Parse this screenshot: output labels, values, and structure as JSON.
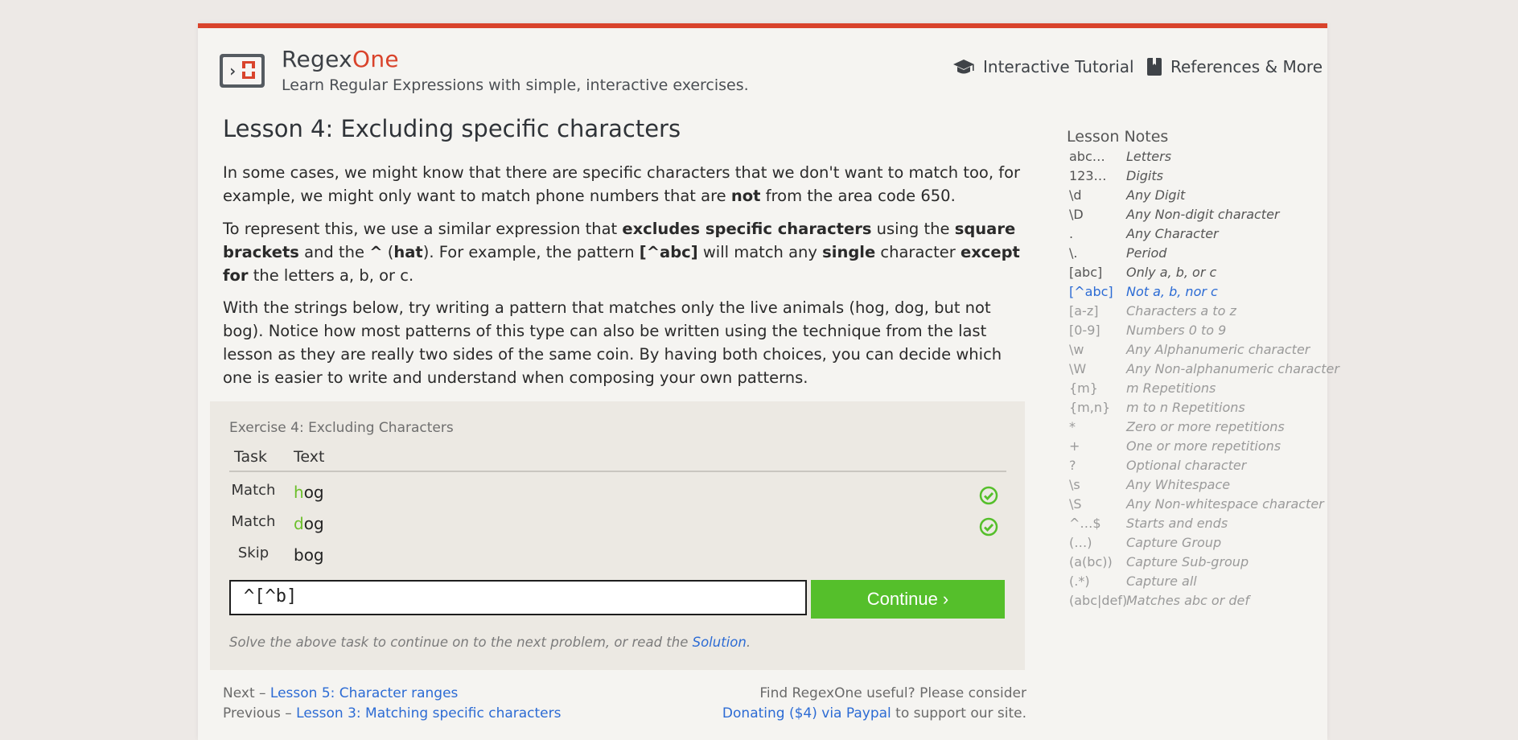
{
  "header": {
    "brand_regex": "Regex",
    "brand_one": "One",
    "tagline": "Learn Regular Expressions with simple, interactive exercises.",
    "nav_tutorial": "Interactive Tutorial",
    "nav_references": "References & More"
  },
  "lesson": {
    "title": "Lesson 4: Excluding specific characters",
    "p1": {
      "a": "In some cases, we might know that there are specific characters that we don't want to match too, for example, we might only want to match phone numbers that are ",
      "b": "not",
      "c": " from the area code 650."
    },
    "p2": {
      "a": "To represent this, we use a similar expression that ",
      "b": "excludes specific characters",
      "c": " using the ",
      "d": "square brackets",
      "e": " and the ",
      "f": "^",
      "g": " (",
      "h": "hat",
      "i": "). For example, the pattern ",
      "j": "[^abc]",
      "k": " will match any ",
      "l": "single",
      "m": " character ",
      "n": "except for",
      "o": " the letters a, b, or c."
    },
    "p3": "With the strings below, try writing a pattern that matches only the live animals (hog, dog, but not bog). Notice how most patterns of this type can also be written using the technique from the last lesson as they are really two sides of the same coin. By having both choices, you can decide which one is easier to write and understand when composing your own patterns."
  },
  "exercise": {
    "title": "Exercise 4: Excluding Characters",
    "col_task": "Task",
    "col_text": "Text",
    "rows": [
      {
        "task": "Match",
        "hl": "h",
        "rest": "og",
        "ok": true
      },
      {
        "task": "Match",
        "hl": "d",
        "rest": "og",
        "ok": true
      },
      {
        "task": "Skip",
        "hl": "",
        "rest": "bog",
        "ok": false
      }
    ],
    "answer": "^[^b]",
    "continue_label": "Continue ›",
    "hint_pre": "Solve the above task to continue on to the next problem, or read the ",
    "hint_link": "Solution",
    "hint_post": "."
  },
  "footer": {
    "next_pre": "Next – ",
    "next_link": "Lesson 5: Character ranges",
    "prev_pre": "Previous – ",
    "prev_link": "Lesson 3: Matching specific characters",
    "donate_line1": "Find RegexOne useful? Please consider",
    "donate_link": "Donating ($4) via Paypal",
    "donate_post": " to support our site."
  },
  "notes": {
    "title": "Lesson Notes",
    "items": [
      {
        "k": "abc…",
        "v": "Letters",
        "state": "past"
      },
      {
        "k": "123…",
        "v": "Digits",
        "state": "past"
      },
      {
        "k": "\\d",
        "v": "Any Digit",
        "state": "past"
      },
      {
        "k": "\\D",
        "v": "Any Non-digit character",
        "state": "past"
      },
      {
        "k": ".",
        "v": "Any Character",
        "state": "past"
      },
      {
        "k": "\\.",
        "v": "Period",
        "state": "past"
      },
      {
        "k": "[abc]",
        "v": "Only a, b, or c",
        "state": "past"
      },
      {
        "k": "[^abc]",
        "v": "Not a, b, nor c",
        "state": "cur"
      },
      {
        "k": "[a-z]",
        "v": "Characters a to z",
        "state": "future"
      },
      {
        "k": "[0-9]",
        "v": "Numbers 0 to 9",
        "state": "future"
      },
      {
        "k": "\\w",
        "v": "Any Alphanumeric character",
        "state": "future"
      },
      {
        "k": "\\W",
        "v": "Any Non-alphanumeric character",
        "state": "future"
      },
      {
        "k": "{m}",
        "v": "m Repetitions",
        "state": "future"
      },
      {
        "k": "{m,n}",
        "v": "m to n Repetitions",
        "state": "future"
      },
      {
        "k": "*",
        "v": "Zero or more repetitions",
        "state": "future"
      },
      {
        "k": "+",
        "v": "One or more repetitions",
        "state": "future"
      },
      {
        "k": "?",
        "v": "Optional character",
        "state": "future"
      },
      {
        "k": "\\s",
        "v": "Any Whitespace",
        "state": "future"
      },
      {
        "k": "\\S",
        "v": "Any Non-whitespace character",
        "state": "future"
      },
      {
        "k": "^…$",
        "v": "Starts and ends",
        "state": "future"
      },
      {
        "k": "(…)",
        "v": "Capture Group",
        "state": "future"
      },
      {
        "k": "(a(bc))",
        "v": "Capture Sub-group",
        "state": "future"
      },
      {
        "k": "(.*)",
        "v": "Capture all",
        "state": "future"
      },
      {
        "k": "(abc|def)",
        "v": "Matches abc or def",
        "state": "future"
      }
    ]
  },
  "colors": {
    "accent": "#d9432b",
    "link": "#2c6bd4",
    "success": "#55bf2b"
  }
}
